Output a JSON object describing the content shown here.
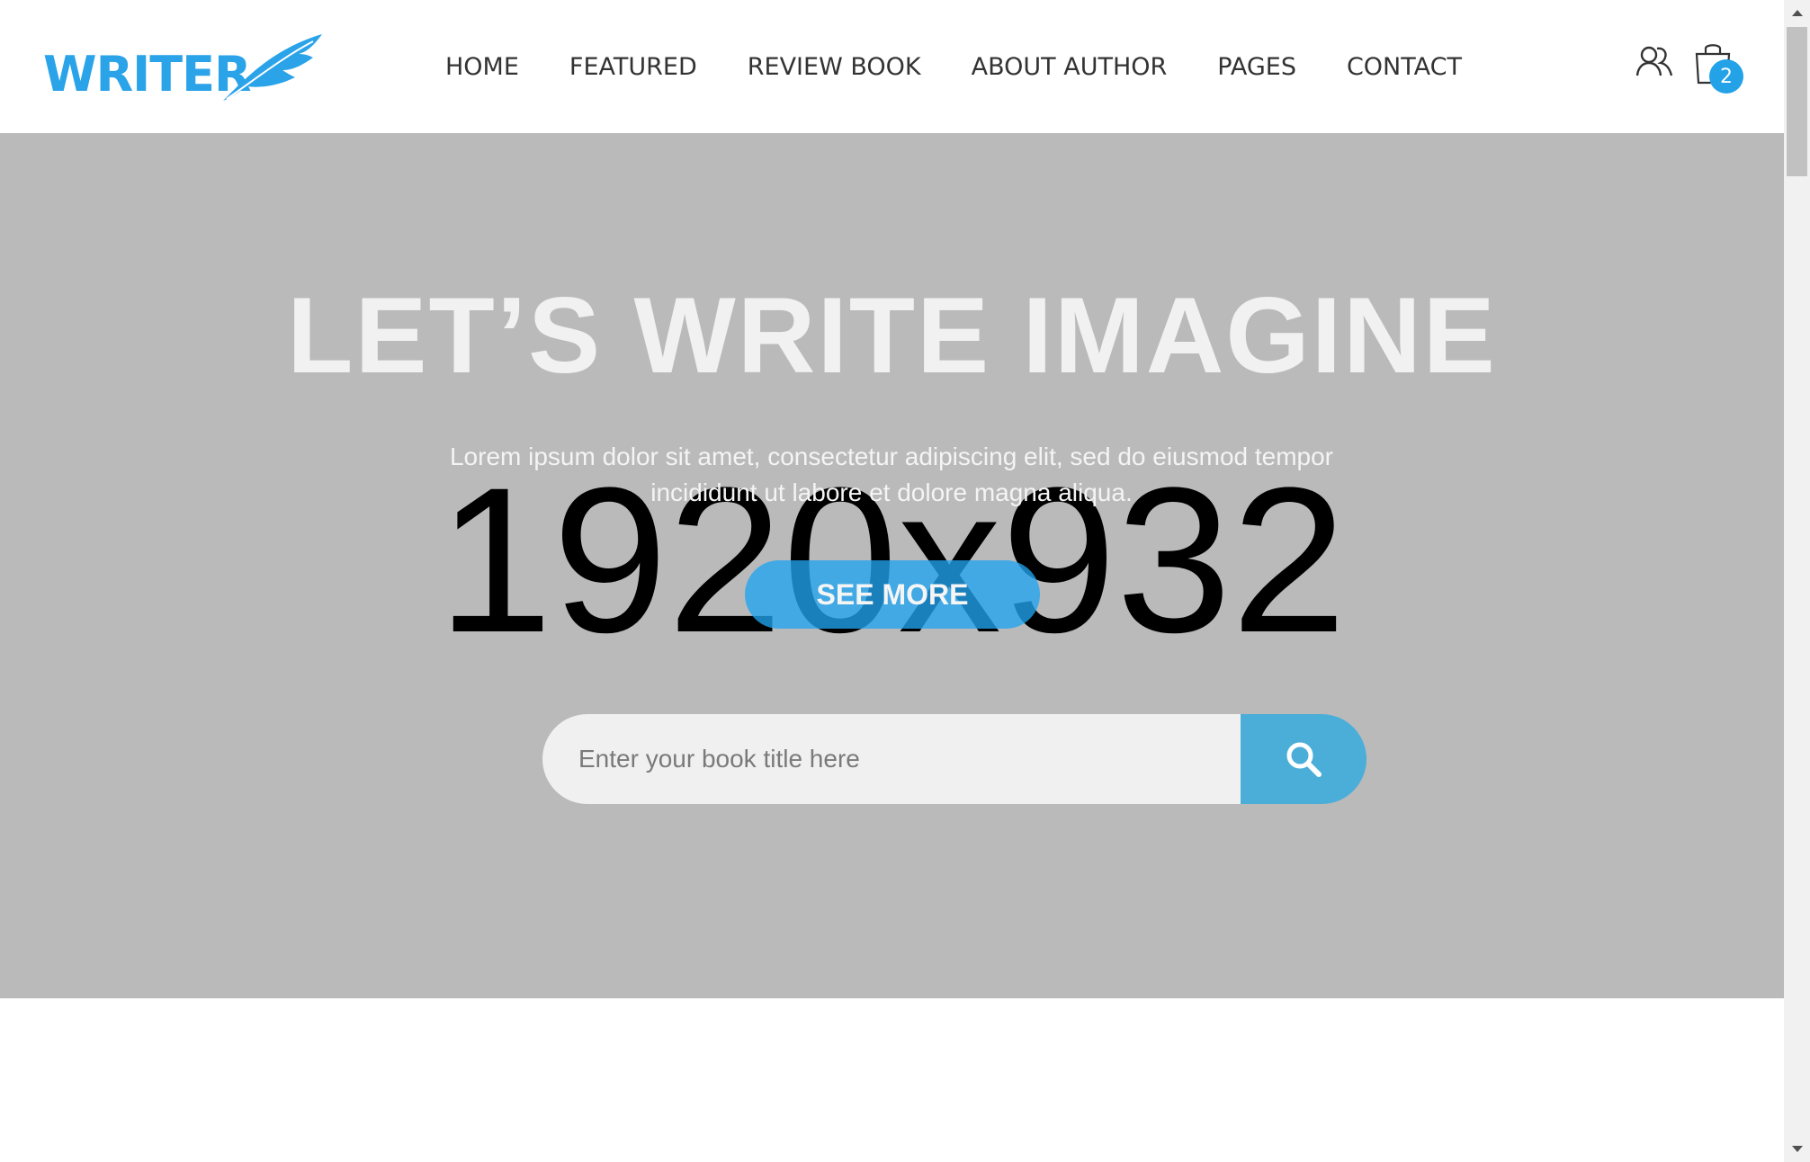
{
  "brand": {
    "logo_text": "WRITER",
    "accent_color": "#2aa3e8",
    "icon": "feather-icon"
  },
  "nav": {
    "items": [
      {
        "label": "HOME"
      },
      {
        "label": "FEATURED"
      },
      {
        "label": "REVIEW BOOK"
      },
      {
        "label": "ABOUT AUTHOR"
      },
      {
        "label": "PAGES"
      },
      {
        "label": "CONTACT"
      }
    ]
  },
  "header_icons": {
    "user_icon": "users-icon",
    "cart_icon": "shopping-bag-icon",
    "cart_count": "2"
  },
  "hero": {
    "placeholder_text": "1920x932",
    "title": "LET’S WRITE IMAGINE",
    "subtitle": "Lorem ipsum dolor sit amet, consectetur adipiscing elit, sed do eiusmod tempor incididunt ut labore et dolore magna aliqua.",
    "cta_label": "SEE MORE",
    "background_color": "#bababa"
  },
  "search": {
    "placeholder": "Enter your book title here",
    "value": "",
    "button_icon": "search-icon",
    "button_color": "#4aaed8"
  }
}
